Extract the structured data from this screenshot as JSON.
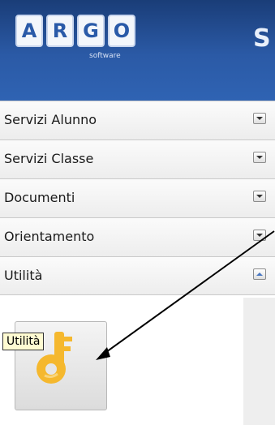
{
  "header": {
    "logo_letters": [
      "A",
      "R",
      "G",
      "O"
    ],
    "logo_subtitle": "software",
    "partial_title": "S"
  },
  "menu": {
    "items": [
      {
        "label": "Servizi Alunno",
        "state": "collapsed"
      },
      {
        "label": "Servizi Classe",
        "state": "collapsed"
      },
      {
        "label": "Documenti",
        "state": "collapsed"
      },
      {
        "label": "Orientamento",
        "state": "collapsed"
      },
      {
        "label": "Utilità",
        "state": "expanded"
      }
    ]
  },
  "panel": {
    "tile_icon": "key-icon",
    "tooltip": "Utilità"
  },
  "colors": {
    "header_dark": "#1a3d78",
    "header_light": "#2f63b3",
    "key_icon": "#f5b82e",
    "tooltip_bg": "#fffbd2"
  }
}
